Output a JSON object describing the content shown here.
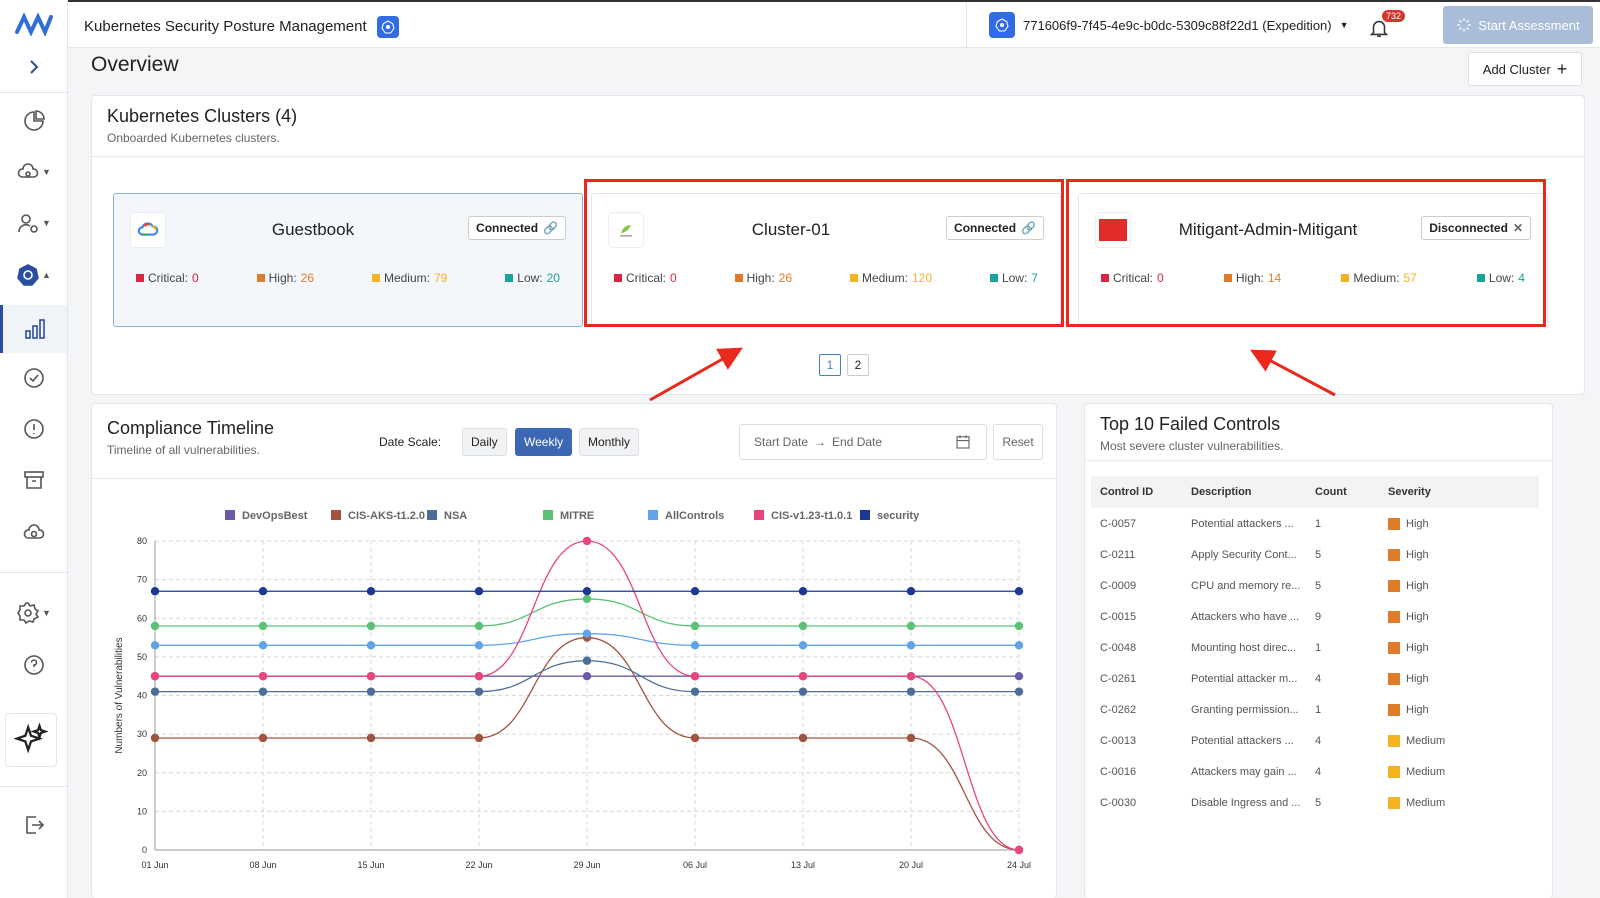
{
  "topbar": {
    "app_title": "Kubernetes Security Posture Management",
    "account": "771606f9-7f45-4e9c-b0dc-5309c88f22d1 (Expedition)",
    "notifications": "732",
    "start_assessment": "Start Assessment"
  },
  "page": {
    "title": "Overview",
    "add_cluster": "Add Cluster"
  },
  "clusters": {
    "title": "Kubernetes Clusters (4)",
    "subtitle": "Onboarded Kubernetes clusters.",
    "labels": {
      "critical": "Critical:",
      "high": "High:",
      "medium": "Medium:",
      "low": "Low:"
    },
    "cards": [
      {
        "name": "Guestbook",
        "status": "Connected",
        "critical": "0",
        "high": "26",
        "medium": "79",
        "low": "20"
      },
      {
        "name": "Cluster-01",
        "status": "Connected",
        "critical": "0",
        "high": "26",
        "medium": "120",
        "low": "7"
      },
      {
        "name": "Mitigant-Admin-Mitigant",
        "status": "Disconnected",
        "critical": "0",
        "high": "14",
        "medium": "57",
        "low": "4"
      }
    ],
    "pages": [
      "1",
      "2"
    ],
    "colors": {
      "critical": "#d7263d",
      "high": "#e07b2a",
      "medium": "#f5b324",
      "low": "#1aa39a"
    }
  },
  "timeline": {
    "title": "Compliance Timeline",
    "subtitle": "Timeline of all vulnerabilities.",
    "date_scale_label": "Date Scale:",
    "scales": [
      "Daily",
      "Weekly",
      "Monthly"
    ],
    "active_scale": "Weekly",
    "start_date": "Start Date",
    "end_date": "End Date",
    "reset": "Reset"
  },
  "chart_data": {
    "type": "line",
    "ylabel": "Numbers of Vulnerabilities",
    "xlabel": "",
    "ylim": [
      0,
      80
    ],
    "yticks": [
      0,
      10,
      20,
      30,
      40,
      50,
      60,
      70,
      80
    ],
    "categories": [
      "01 Jun",
      "08 Jun",
      "15 Jun",
      "22 Jun",
      "29 Jun",
      "06 Jul",
      "13 Jul",
      "20 Jul",
      "24 Jul"
    ],
    "grid": true,
    "legend_position": "top",
    "series": [
      {
        "name": "DevOpsBest",
        "color": "#6b5aa8",
        "values": [
          45,
          45,
          45,
          45,
          45,
          45,
          45,
          45,
          45
        ]
      },
      {
        "name": "CIS-AKS-t1.2.0",
        "color": "#a0543f",
        "values": [
          29,
          29,
          29,
          29,
          55,
          29,
          29,
          29,
          0
        ]
      },
      {
        "name": "NSA",
        "color": "#4c6e96",
        "values": [
          41,
          41,
          41,
          41,
          49,
          41,
          41,
          41,
          41
        ]
      },
      {
        "name": "MITRE",
        "color": "#59c274",
        "values": [
          58,
          58,
          58,
          58,
          65,
          58,
          58,
          58,
          58
        ]
      },
      {
        "name": "AllControls",
        "color": "#5fa4e8",
        "values": [
          53,
          53,
          53,
          53,
          56,
          53,
          53,
          53,
          53
        ]
      },
      {
        "name": "CIS-v1.23-t1.0.1",
        "color": "#e8457d",
        "values": [
          45,
          45,
          45,
          45,
          80,
          45,
          45,
          45,
          0
        ]
      },
      {
        "name": "security",
        "color": "#1c3893",
        "values": [
          67,
          67,
          67,
          67,
          67,
          67,
          67,
          67,
          67
        ]
      }
    ]
  },
  "controls": {
    "title": "Top 10 Failed Controls",
    "subtitle": "Most severe cluster vulnerabilities.",
    "columns": [
      "Control ID",
      "Description",
      "Count",
      "Severity"
    ],
    "rows": [
      {
        "id": "C-0057",
        "desc": "Potential attackers ...",
        "count": "1",
        "severity": "High",
        "color": "#e07b2a"
      },
      {
        "id": "C-0211",
        "desc": "Apply Security Cont...",
        "count": "5",
        "severity": "High",
        "color": "#e07b2a"
      },
      {
        "id": "C-0009",
        "desc": "CPU and memory re...",
        "count": "5",
        "severity": "High",
        "color": "#e07b2a"
      },
      {
        "id": "C-0015",
        "desc": "Attackers who have ...",
        "count": "9",
        "severity": "High",
        "color": "#e07b2a"
      },
      {
        "id": "C-0048",
        "desc": "Mounting host direc...",
        "count": "1",
        "severity": "High",
        "color": "#e07b2a"
      },
      {
        "id": "C-0261",
        "desc": "Potential attacker m...",
        "count": "4",
        "severity": "High",
        "color": "#e07b2a"
      },
      {
        "id": "C-0262",
        "desc": "Granting permission...",
        "count": "1",
        "severity": "High",
        "color": "#e07b2a"
      },
      {
        "id": "C-0013",
        "desc": "Potential attackers ...",
        "count": "4",
        "severity": "Medium",
        "color": "#f5b324"
      },
      {
        "id": "C-0016",
        "desc": "Attackers may gain ...",
        "count": "4",
        "severity": "Medium",
        "color": "#f5b324"
      },
      {
        "id": "C-0030",
        "desc": "Disable Ingress and ...",
        "count": "5",
        "severity": "Medium",
        "color": "#f5b324"
      }
    ]
  }
}
